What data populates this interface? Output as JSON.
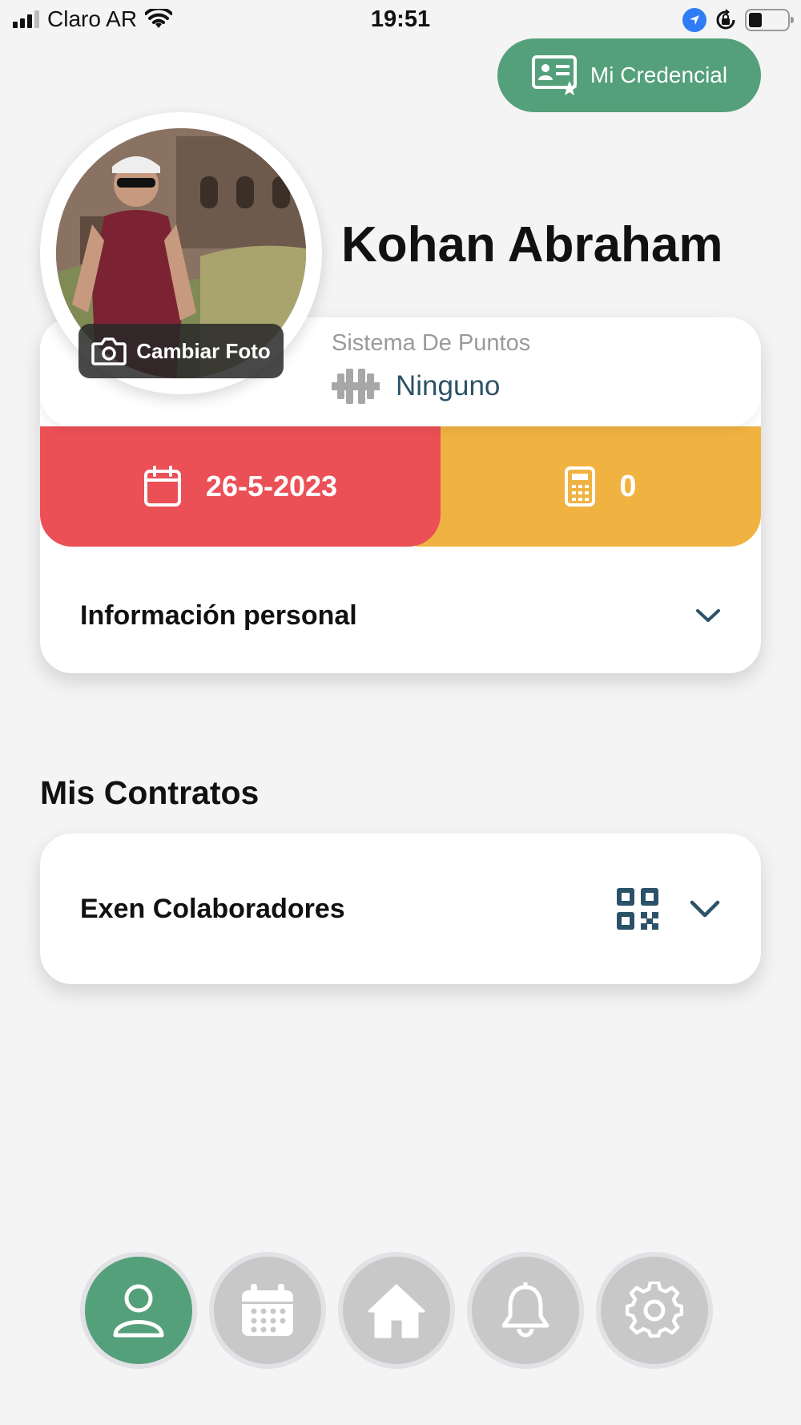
{
  "status_bar": {
    "carrier": "Claro AR",
    "time": "19:51"
  },
  "header": {
    "credential_button": "Mi Credencial"
  },
  "profile": {
    "name": "Kohan Abraham",
    "change_photo": "Cambiar Foto",
    "points_label": "Sistema De Puntos",
    "points_value": "Ninguno",
    "date": "26-5-2023",
    "count": "0",
    "personal_info": "Información personal"
  },
  "contracts": {
    "title": "Mis Contratos",
    "items": [
      {
        "name": "Exen Colaboradores"
      }
    ]
  },
  "nav": {
    "items": [
      {
        "icon": "user-icon",
        "active": true
      },
      {
        "icon": "calendar-icon",
        "active": false
      },
      {
        "icon": "home-icon",
        "active": false
      },
      {
        "icon": "bell-icon",
        "active": false
      },
      {
        "icon": "gear-icon",
        "active": false
      }
    ]
  },
  "colors": {
    "accent_green": "#54a07a",
    "date_red": "#ea5056",
    "count_yellow": "#f0b241",
    "points_blue": "#2b5268"
  }
}
